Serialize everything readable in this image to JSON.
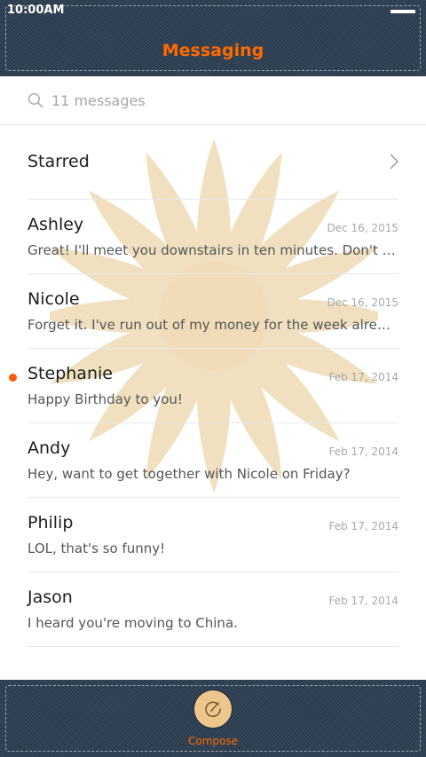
{
  "status": {
    "time": "10:00AM"
  },
  "header": {
    "title": "Messaging"
  },
  "search": {
    "placeholder": "11 messages"
  },
  "starred": {
    "label": "Starred"
  },
  "messages": [
    {
      "name": "Ashley",
      "date": "Dec 16, 2015",
      "preview": "Great! I'll meet you downstairs in ten minutes. Don't forge…",
      "unread": false
    },
    {
      "name": "Nicole",
      "date": "Dec 16, 2015",
      "preview": "Forget it. I've run out of my money for the week already.",
      "unread": false
    },
    {
      "name": "Stephanie",
      "date": "Feb 17, 2014",
      "preview": "Happy Birthday to you!",
      "unread": true
    },
    {
      "name": "Andy",
      "date": "Feb 17, 2014",
      "preview": "Hey, want to get together with Nicole on Friday?",
      "unread": false
    },
    {
      "name": "Philip",
      "date": "Feb 17, 2014",
      "preview": "LOL, that's so funny!",
      "unread": false
    },
    {
      "name": "Jason",
      "date": "Feb 17, 2014",
      "preview": "I heard you're moving to China.",
      "unread": false
    }
  ],
  "footer": {
    "compose_label": "Compose"
  },
  "colors": {
    "accent": "#ff6a00",
    "denim": "#2f4255",
    "unread": "#ff5a0a",
    "flower": "#efdcb8"
  }
}
